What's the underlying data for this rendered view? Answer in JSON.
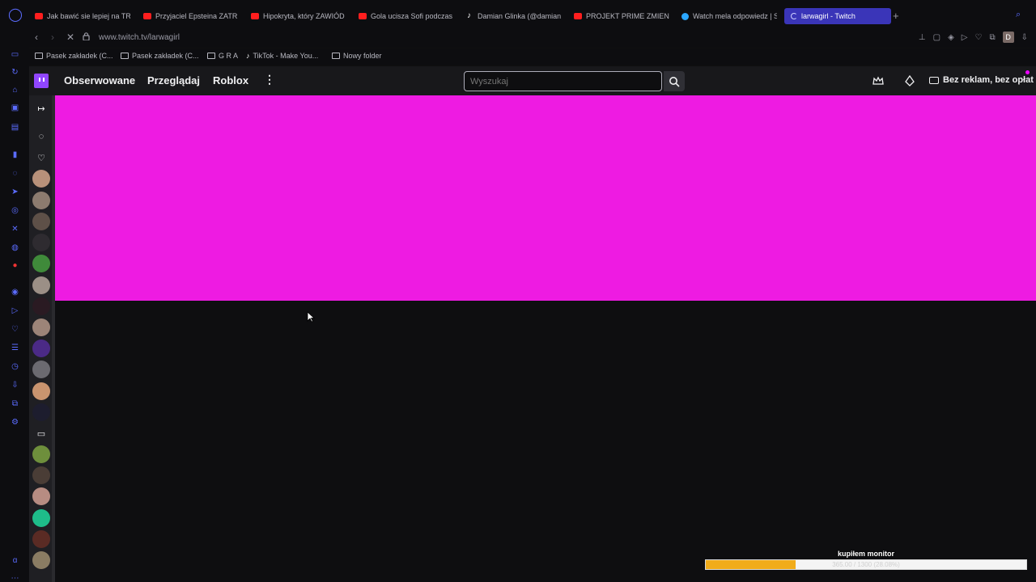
{
  "browser": {
    "tabs": [
      {
        "label": "Jak bawić sie lepiej na TR",
        "favicon": "youtube-icon"
      },
      {
        "label": "Przyjaciel Epsteina ZATRZ",
        "favicon": "youtube-icon"
      },
      {
        "label": "Hipokryta, który ZAWIÓD",
        "favicon": "youtube-icon"
      },
      {
        "label": "Gola ucisza Sofi podczas",
        "favicon": "youtube-icon"
      },
      {
        "label": "Damian Glinka (@damian_",
        "favicon": "tiktok-icon"
      },
      {
        "label": "PROJEKT PRIME ZMIENIA",
        "favicon": "youtube-icon"
      },
      {
        "label": "Watch mela odpowiedz | S",
        "favicon": "chatgpt-icon"
      },
      {
        "label": "larwagirl - Twitch",
        "favicon": "loading-icon",
        "active": true
      }
    ],
    "url": "www.twitch.tv/larwagirl",
    "profile_initial": "D",
    "bookmarks": [
      {
        "label": "Pasek zakładek (C...",
        "icon": "folder-icon"
      },
      {
        "label": "Pasek zakładek (C...",
        "icon": "folder-icon"
      },
      {
        "label": "G R A",
        "icon": "folder-icon"
      },
      {
        "label": "TikTok - Make You...",
        "icon": "tiktok-icon"
      },
      {
        "label": "Nowy folder",
        "icon": "folder-icon"
      }
    ]
  },
  "twitch": {
    "nav": {
      "following": "Obserwowane",
      "browse": "Przeglądaj",
      "game": "Roblox",
      "more": "⋮",
      "search_placeholder": "Wyszukaj",
      "ad_free": "Bez reklam, bez opłat"
    },
    "banner_color": "#ee1be2"
  },
  "overlay": {
    "goal_title": "kupiłem monitor",
    "goal_progress_text": "365.00 / 1300 (28.08%)",
    "goal_fraction": 0.2808,
    "fill_color": "#f1ac1a"
  }
}
